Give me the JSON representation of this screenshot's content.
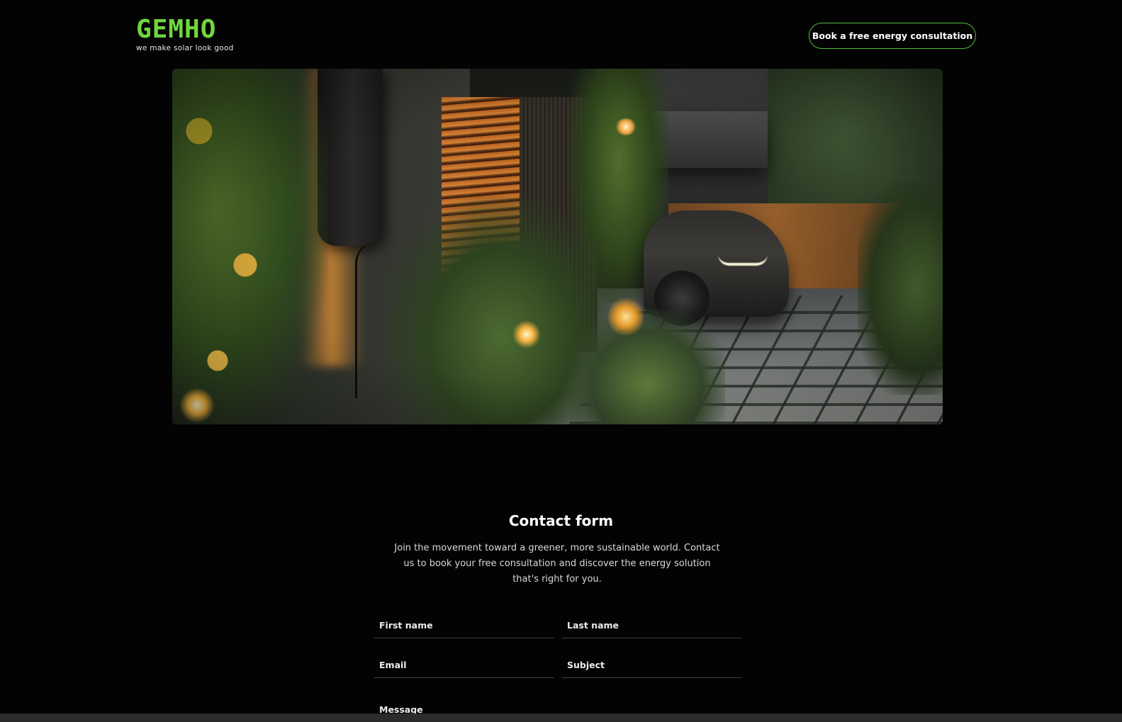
{
  "header": {
    "logo_text": "GEMHO",
    "tagline": "we make solar look good",
    "cta_label": "Book a free energy consultation"
  },
  "hero": {
    "subject": "ev-charger-garden-driveway"
  },
  "contact": {
    "title": "Contact form",
    "intro": "Join the movement toward a greener, more sustainable world. Contact us to book your free consultation and discover the energy solution that's right for you.",
    "fields": {
      "first_name": "First name",
      "last_name": "Last name",
      "email": "Email",
      "subject": "Subject",
      "message": "Message"
    }
  },
  "colors": {
    "background": "#030303",
    "brand_green": "#6fd63e",
    "cta_border": "#4fbf3a",
    "text": "#ffffff"
  }
}
